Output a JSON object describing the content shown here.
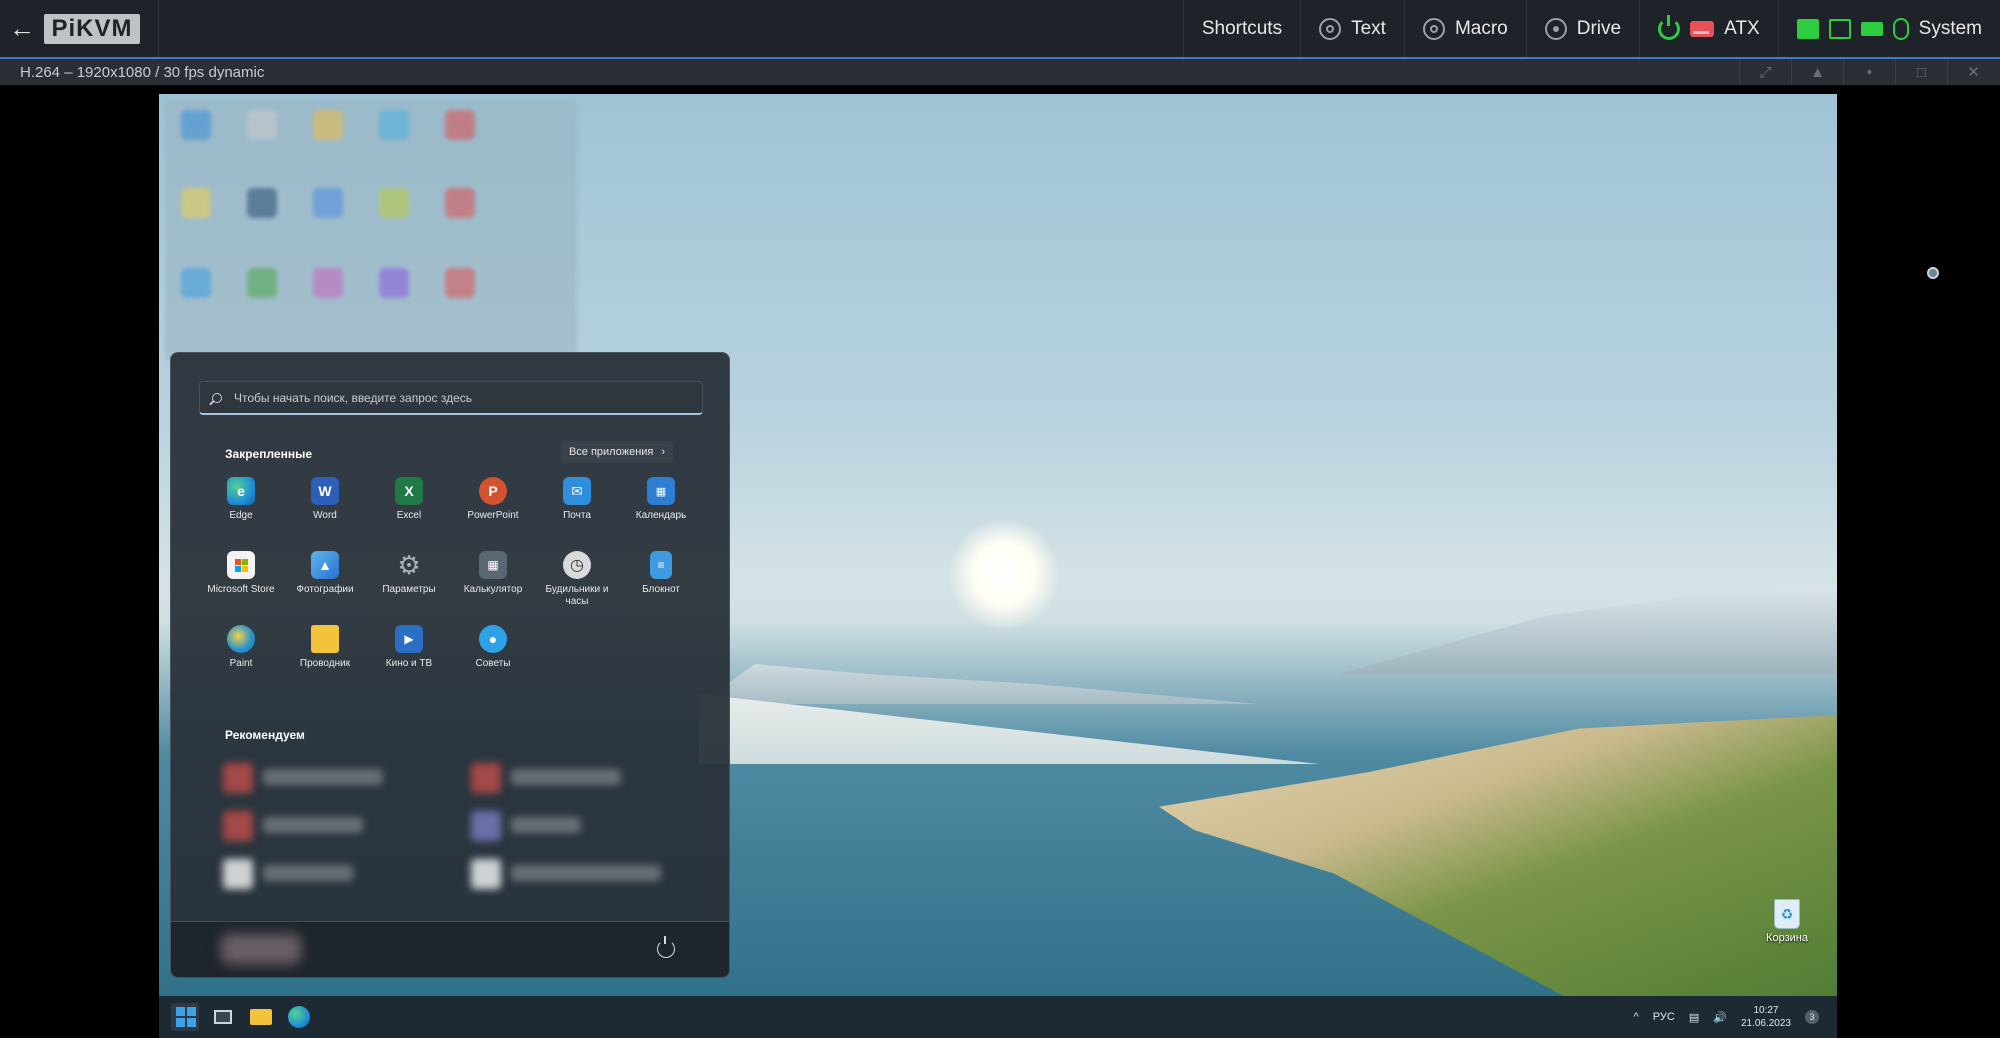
{
  "topbar": {
    "back_icon": "arrow-left-icon",
    "logo": "PiKVM",
    "menu": [
      {
        "label": "Shortcuts"
      },
      {
        "label": "Text",
        "icon": "gear-icon"
      },
      {
        "label": "Macro",
        "icon": "gear-icon"
      },
      {
        "label": "Drive",
        "icon": "drive-icon"
      },
      {
        "label": "ATX",
        "icons": [
          "power-icon",
          "hdd-icon"
        ]
      },
      {
        "label": "System",
        "icons": [
          "network-icon",
          "monitor-icon",
          "keyboard-icon",
          "mouse-icon"
        ]
      }
    ],
    "colors": {
      "status_green": "#2ecc40",
      "hdd_red": "#e8515a",
      "bar_bg": "#1e2229"
    }
  },
  "stream": {
    "title": "H.264 – 1920x1080 / 30 fps dynamic",
    "controls": [
      "fullscreen-icon",
      "warning-icon",
      "dot-icon",
      "maximize-icon",
      "close-icon"
    ]
  },
  "start_menu": {
    "search_placeholder": "Чтобы начать поиск, введите запрос здесь",
    "pinned_title": "Закрепленные",
    "all_apps_label": "Все приложения",
    "pinned": [
      {
        "label": "Edge",
        "color": "#1f8fd8"
      },
      {
        "label": "Word",
        "color": "#2b5fb8"
      },
      {
        "label": "Excel",
        "color": "#1f7a45"
      },
      {
        "label": "PowerPoint",
        "color": "#d35230"
      },
      {
        "label": "Почта",
        "color": "#2f8fdc"
      },
      {
        "label": "Календарь",
        "color": "#2d7fd3"
      },
      {
        "label": "Microsoft Store",
        "color": "#f3f3f3"
      },
      {
        "label": "Фотографии",
        "color": "#2c88d9"
      },
      {
        "label": "Параметры",
        "color": "#6f7880"
      },
      {
        "label": "Калькулятор",
        "color": "#5a6670"
      },
      {
        "label": "Будильники и часы",
        "color": "#d9dadb"
      },
      {
        "label": "Блокнот",
        "color": "#3e9be0"
      },
      {
        "label": "Paint",
        "color": "#2d95c9"
      },
      {
        "label": "Проводник",
        "color": "#f3c33c"
      },
      {
        "label": "Кино и ТВ",
        "color": "#2a6fc4"
      },
      {
        "label": "Советы",
        "color": "#2fa1e6"
      }
    ],
    "recommended_title": "Рекомендуем"
  },
  "desktop": {
    "recycle_bin_label": "Корзина"
  },
  "taskbar": {
    "icons": [
      "windows-start-icon",
      "task-view-icon",
      "file-explorer-icon",
      "edge-icon"
    ],
    "tray": {
      "chevron": "^",
      "language": "РУС",
      "time": "10:27",
      "date": "21.06.2023",
      "notification_count": "3"
    }
  }
}
